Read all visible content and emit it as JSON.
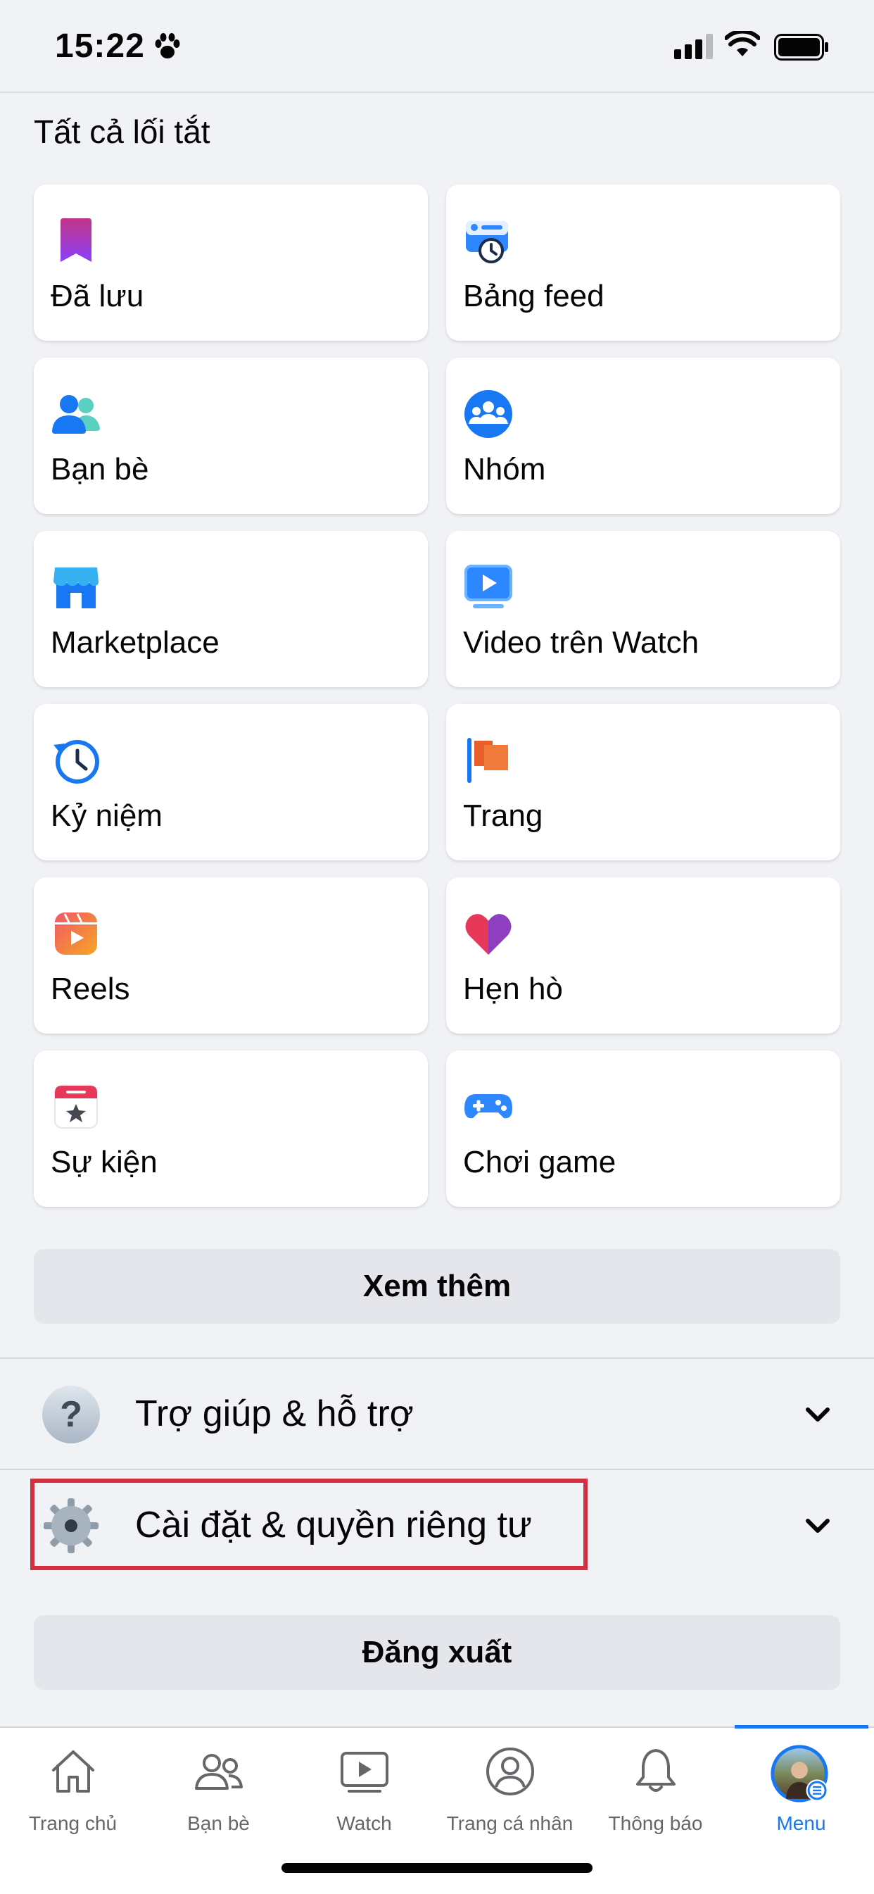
{
  "status_bar": {
    "time": "15:22"
  },
  "shortcuts": {
    "title": "Tất cả lối tắt",
    "items": [
      {
        "label": "Đã lưu",
        "icon": "bookmark-icon"
      },
      {
        "label": "Bảng feed",
        "icon": "feed-clock-icon"
      },
      {
        "label": "Bạn bè",
        "icon": "friends-icon"
      },
      {
        "label": "Nhóm",
        "icon": "groups-icon"
      },
      {
        "label": "Marketplace",
        "icon": "marketplace-store-icon"
      },
      {
        "label": "Video trên Watch",
        "icon": "watch-video-icon"
      },
      {
        "label": "Kỷ niệm",
        "icon": "memories-clock-icon"
      },
      {
        "label": "Trang",
        "icon": "pages-flag-icon"
      },
      {
        "label": "Reels",
        "icon": "reels-icon"
      },
      {
        "label": "Hẹn hò",
        "icon": "dating-heart-icon"
      },
      {
        "label": "Sự kiện",
        "icon": "events-calendar-icon"
      },
      {
        "label": "Chơi game",
        "icon": "gaming-controller-icon"
      }
    ],
    "see_more_label": "Xem thêm"
  },
  "sections": {
    "help": {
      "label": "Trợ giúp & hỗ trợ",
      "icon": "question-icon"
    },
    "settings": {
      "label": "Cài đặt & quyền riêng tư",
      "icon": "gear-icon"
    }
  },
  "logout_label": "Đăng xuất",
  "tabbar": {
    "tabs": [
      {
        "label": "Trang chủ",
        "icon": "home-icon"
      },
      {
        "label": "Bạn bè",
        "icon": "friends-outline-icon"
      },
      {
        "label": "Watch",
        "icon": "watch-icon"
      },
      {
        "label": "Trang cá nhân",
        "icon": "profile-icon"
      },
      {
        "label": "Thông báo",
        "icon": "bell-icon"
      },
      {
        "label": "Menu",
        "icon": "avatar-menu-icon"
      }
    ],
    "active_tab": "Menu"
  },
  "colors": {
    "accent": "#1877f2",
    "highlight_border": "#d0303f",
    "background": "#f0f2f5"
  }
}
